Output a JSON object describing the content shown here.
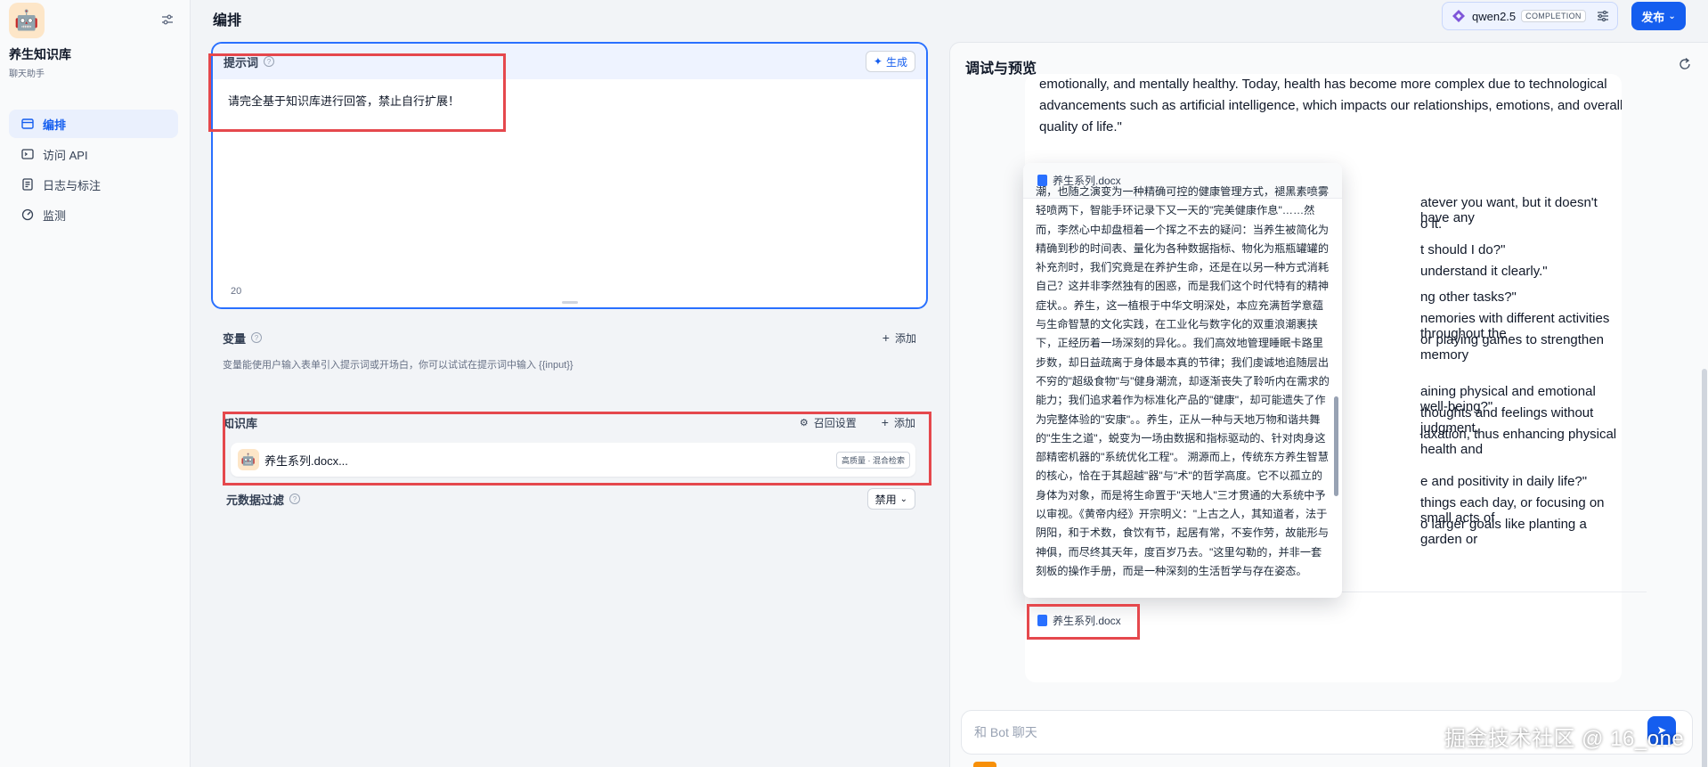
{
  "sidebar": {
    "app_name": "养生知识库",
    "app_subtitle": "聊天助手",
    "items": [
      {
        "label": "编排",
        "icon": "layout-icon",
        "active": true
      },
      {
        "label": "访问 API",
        "icon": "terminal-icon",
        "active": false
      },
      {
        "label": "日志与标注",
        "icon": "log-icon",
        "active": false
      },
      {
        "label": "监测",
        "icon": "monitor-icon",
        "active": false
      }
    ]
  },
  "header": {
    "title": "编排",
    "model_name": "qwen2.5",
    "model_tag": "COMPLETION",
    "publish_label": "发布"
  },
  "prompt": {
    "title": "提示词",
    "generate_label": "生成",
    "content": "请完全基于知识库进行回答，禁止自行扩展！",
    "char_count": "20"
  },
  "variables": {
    "title": "变量",
    "add_label": "添加",
    "hint": "变量能使用户输入表单引入提示词或开场白，你可以试试在提示词中输入 {{input}}"
  },
  "knowledge": {
    "title": "知识库",
    "recall_label": "召回设置",
    "add_label": "添加",
    "item_name": "养生系列.docx...",
    "item_badge": "高质量 · 混合检索",
    "metadata_title": "元数据过滤",
    "metadata_value": "禁用"
  },
  "preview": {
    "title": "调试与预览",
    "answer_lines": [
      "emotionally, and mentally healthy. Today, health has become more complex due to technological",
      "advancements such as artificial intelligence, which impacts our relationships, emotions, and overall",
      "quality of life.\""
    ],
    "hidden_fragments": [
      "atever you want, but it doesn't have any",
      "o it.",
      "t should I do?\"",
      "understand it clearly.\"",
      "ng other tasks?\"",
      "nemories with different activities throughout the",
      "or playing games to strengthen memory",
      "aining physical and emotional well-being?\"",
      "thoughts and feelings without judgment,",
      "laxation, thus enhancing physical health and",
      "e and positivity in daily life?\"",
      "things each day, or focusing on small acts of",
      "o larger goals like planting a garden or"
    ],
    "popup_title": "养生系列.docx",
    "popup_text": "潮，也随之演变为一种精确可控的健康管理方式，褪黑素喷雾轻喷两下，智能手环记录下又一天的\"完美健康作息\"……然而，李然心中却盘桓着一个挥之不去的疑问：当养生被简化为精确到秒的时间表、量化为各种数据指标、物化为瓶瓶罐罐的补充剂时，我们究竟是在养护生命，还是在以另一种方式消耗自己？这并非李然独有的困惑，而是我们这个时代特有的精神症状。。养生，这一植根于中华文明深处，本应充满哲学意蕴与生命智慧的文化实践，在工业化与数字化的双重浪潮裹挟下，正经历着一场深刻的异化。。我们高效地管理睡眠卡路里步数，却日益疏离于身体最本真的节律；我们虔诚地追随层出不穷的\"超级食物\"与\"健身潮流，却逐渐丧失了聆听内在需求的能力；我们追求着作为标准化产品的\"健康\"，却可能遗失了作为完整体验的\"安康\"。。养生，正从一种与天地万物和谐共舞的\"生生之道\"，蜕变为一场由数据和指标驱动的、针对肉身这部精密机器的\"系统优化工程\"。 溯源而上，传统东方养生智慧的核心，恰在于其超越\"器\"与\"术\"的哲学高度。它不以孤立的身体为对象，而是将生命置于\"天地人\"三才贯通的大系统中予以审视。《黄帝内经》开宗明义：\"上古之人，其知道者，法于阴阳，和于术数，食饮有节，起居有常，不妄作劳，故能形与神俱，而尽终其天年，度百岁乃去。\"这里勾勒的，并非一套刻板的操作手册，而是一种深刻的生活哲学与存在姿态。",
    "citation_label": "养生系列.docx",
    "chat_placeholder": "和 Bot 聊天"
  },
  "watermark": "掘金技术社区 @ 16_one",
  "colors": {
    "accent": "#155eef",
    "highlight_box": "#e5484d",
    "prompt_border": "#2970ff"
  }
}
